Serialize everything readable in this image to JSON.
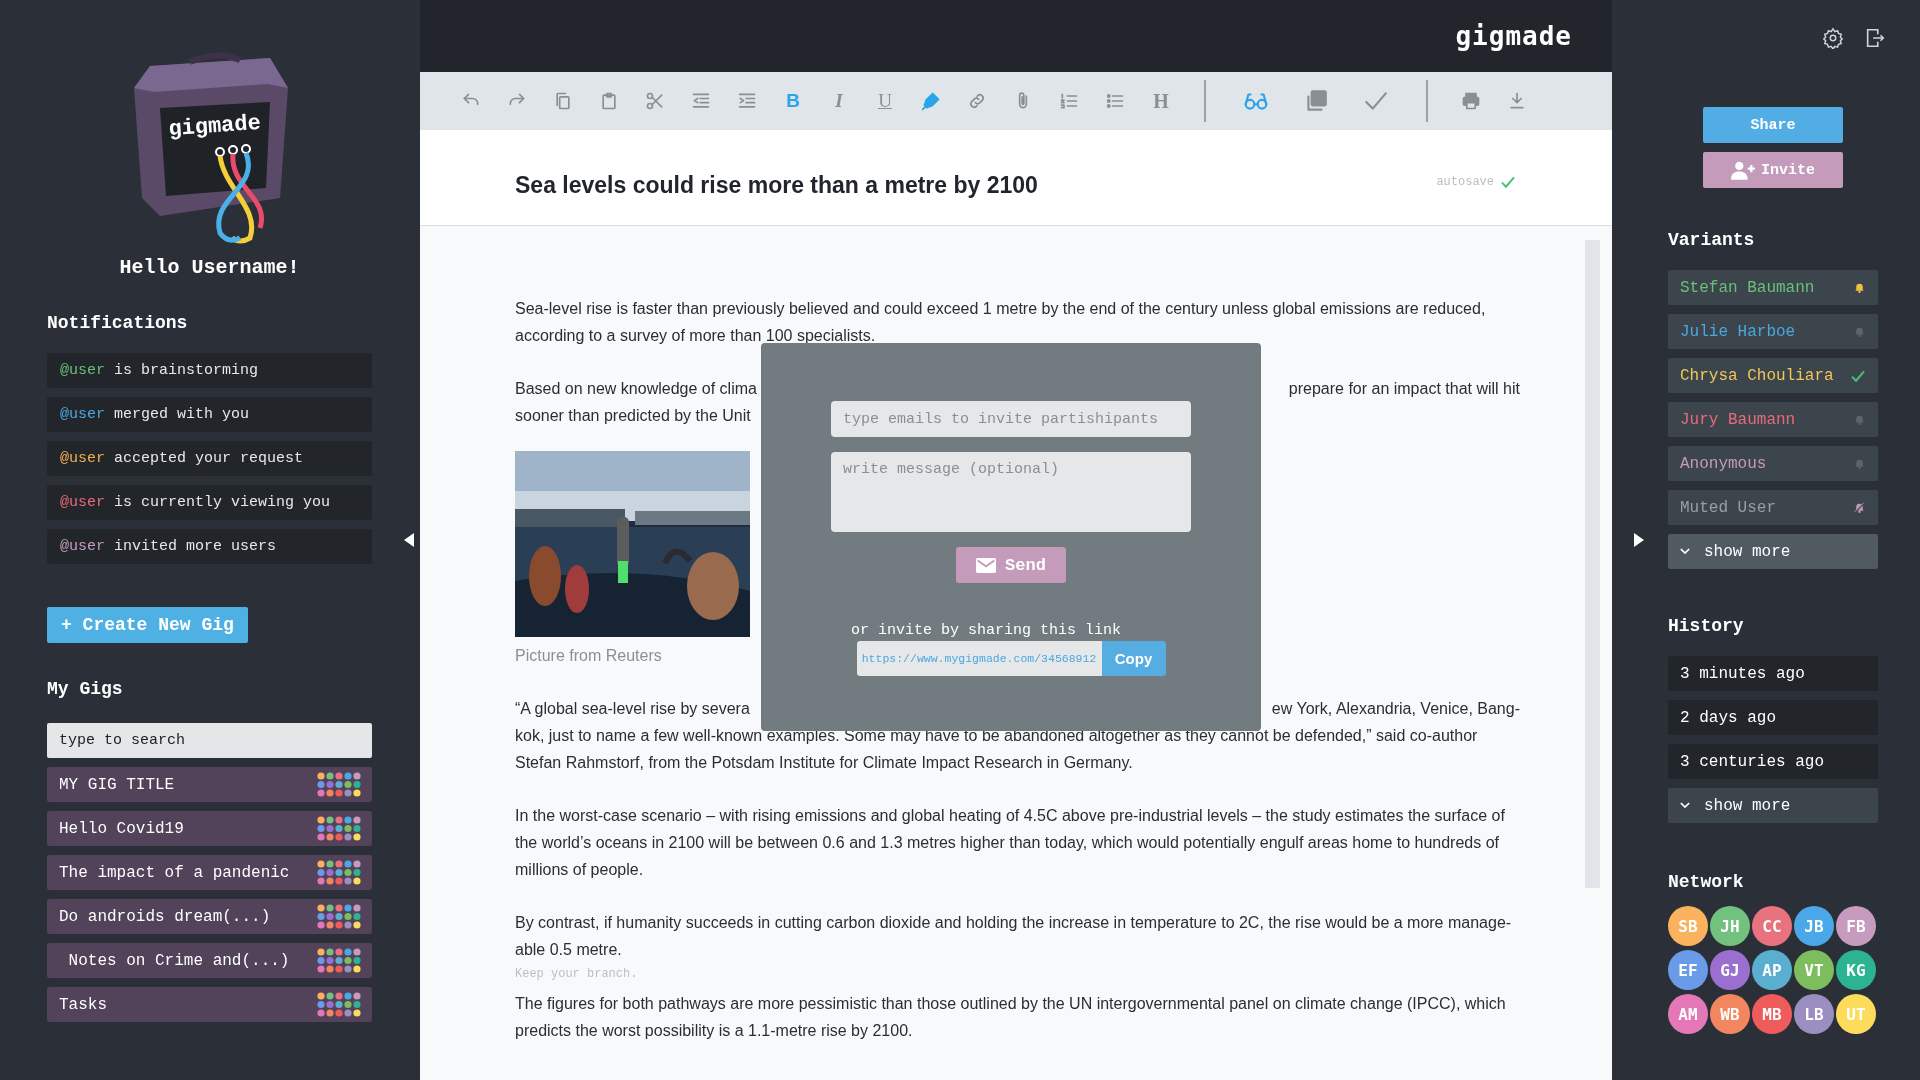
{
  "sidebar_left": {
    "logo_text": "gigmade",
    "greeting": "Hello Username!",
    "notifications_title": "Notifications",
    "notifications": [
      {
        "user": "@user",
        "text": "is brainstorming",
        "color": "#6abf7b"
      },
      {
        "user": "@user",
        "text": "merged with you",
        "color": "#4aa8e0"
      },
      {
        "user": "@user",
        "text": "accepted your request",
        "color": "#f0b04f"
      },
      {
        "user": "@user",
        "text": "is currently viewing you",
        "color": "#e96a7a"
      },
      {
        "user": "@user",
        "text": "invited more users",
        "color": "#c49bbb"
      }
    ],
    "create_button": "+ Create New Gig",
    "gigs_title": "My Gigs",
    "search": {
      "placeholder": "type to search"
    },
    "gigs": [
      {
        "title": "MY GIG TITLE"
      },
      {
        "title": "Hello Covid19"
      },
      {
        "title": "The impact of a pandenic"
      },
      {
        "title": "Do androids dream(...)"
      },
      {
        "title": " Notes on Crime and(...)"
      },
      {
        "title": "Tasks"
      }
    ]
  },
  "header": {
    "brand": "gigmade"
  },
  "toolbar": {
    "groups": [
      {
        "tools": [
          {
            "kind": "undo",
            "active": false
          },
          {
            "kind": "redo",
            "active": false
          },
          {
            "kind": "copy",
            "active": false
          },
          {
            "kind": "paste",
            "active": false
          },
          {
            "kind": "cut",
            "active": false
          },
          {
            "kind": "outdent",
            "active": false
          },
          {
            "kind": "indent",
            "active": false
          },
          {
            "kind": "bold",
            "glyph": "B",
            "active": true
          },
          {
            "kind": "italic",
            "glyph": "I",
            "active": false
          },
          {
            "kind": "underline",
            "glyph": "U",
            "active": false
          },
          {
            "kind": "highlight",
            "active": true
          },
          {
            "kind": "link",
            "active": false
          },
          {
            "kind": "attach",
            "active": false
          },
          {
            "kind": "ordered-list",
            "active": false
          },
          {
            "kind": "bullet-list",
            "active": false
          },
          {
            "kind": "heading",
            "glyph": "H",
            "active": false
          }
        ]
      },
      {
        "tools": [
          {
            "kind": "glasses",
            "active": true
          },
          {
            "kind": "copies",
            "active": false
          },
          {
            "kind": "check",
            "active": false
          }
        ]
      },
      {
        "tools": [
          {
            "kind": "print",
            "active": false
          },
          {
            "kind": "download",
            "active": false
          }
        ]
      }
    ]
  },
  "document": {
    "title": "Sea levels could rise more than a metre by 2100",
    "autosave": "autosave",
    "blocks": [
      {
        "kind": "text",
        "text": "Sea-level rise is faster than previously believed and could exceed 1 metre by the end of the century unless global emissions are reduced, according to a survey of more than 100 specialists."
      },
      {
        "kind": "lines",
        "lines": [
          {
            "left": "Based on new knowledge of clima",
            "right": "prepare for an impact that will hit"
          },
          {
            "left": "sooner than predicted by the Unit"
          }
        ]
      },
      {
        "kind": "picture",
        "caption": "Picture from Reuters"
      },
      {
        "kind": "lines",
        "lines": [
          {
            "left": "“A global sea-level rise by severa",
            "right": "ew York, Alexandria, Venice, Bang-"
          },
          {
            "left": "kok, just to name a few well-known examples. Some may have to be abandoned altogether as they cannot be defended,” said co-author"
          },
          {
            "left": "Stefan Rahmstorf, from the Potsdam Institute for Climate Impact Research in Germany."
          }
        ]
      },
      {
        "kind": "text",
        "text": "In the worst-case scenario – with rising emissions and global heating of 4.5C above pre-industrial levels – the study estimates the surface of the world’s oceans in 2100 will be between 0.6 and 1.3 metres higher than today, which would potentially engulf areas home to hundreds of millions of people."
      },
      {
        "kind": "text",
        "text": "By contrast, if humanity succeeds in cutting carbon dioxide and holding the increase in temperature to 2C, the rise would be a more manage-able 0.5 metre."
      },
      {
        "kind": "note",
        "text": "Keep your branch."
      },
      {
        "kind": "text",
        "text": "The figures for both pathways are more pessimistic than those outlined by the UN intergovernmental panel on climate change (IPCC), which predicts the worst possibility is a 1.1-metre rise by 2100."
      }
    ]
  },
  "invite_dialog": {
    "email_placeholder": "type emails to invite partishipants",
    "message_placeholder": "write message (optional)",
    "send": "Send",
    "share_label": "or invite by sharing this link",
    "link": "https://www.mygigmade.com/34568912",
    "copy": "Copy"
  },
  "sidebar_right": {
    "share": "Share",
    "invite": "Invite",
    "variants_title": "Variants",
    "variants": [
      {
        "name": "Stefan Baumann",
        "color": "#6abf7b",
        "kind": "bell",
        "notify": true
      },
      {
        "name": "Julie Harboe",
        "color": "#4aa8e0",
        "kind": "bell",
        "notify": false
      },
      {
        "name": "Chrysa Chouliara",
        "color": "#f0c85a",
        "kind": "check"
      },
      {
        "name": "Jury Baumann",
        "color": "#e96a7a",
        "kind": "bell",
        "notify": false
      },
      {
        "name": "Anonymous",
        "color": "#c49bbb",
        "kind": "bell",
        "notify": false
      },
      {
        "name": "Muted User",
        "color": "#9a9ea3",
        "kind": "muted"
      }
    ],
    "variants_more": "show more",
    "history_title": "History",
    "history": [
      {
        "label": "3 minutes ago"
      },
      {
        "label": "2 days ago"
      },
      {
        "label": "3 centuries ago"
      }
    ],
    "history_more": "show more",
    "network_title": "Network",
    "network": [
      {
        "initials": "SB",
        "color": "#fbb25e"
      },
      {
        "initials": "JH",
        "color": "#72c17f"
      },
      {
        "initials": "CC",
        "color": "#e8727d"
      },
      {
        "initials": "JB",
        "color": "#4aa8e8"
      },
      {
        "initials": "FB",
        "color": "#c69bbd"
      },
      {
        "initials": "EF",
        "color": "#6a9be8"
      },
      {
        "initials": "GJ",
        "color": "#9b6fd0"
      },
      {
        "initials": "AP",
        "color": "#5aaed0"
      },
      {
        "initials": "VT",
        "color": "#7dbd5e"
      },
      {
        "initials": "KG",
        "color": "#2bb392"
      },
      {
        "initials": "AM",
        "color": "#e377b7"
      },
      {
        "initials": "WB",
        "color": "#f3855f"
      },
      {
        "initials": "MB",
        "color": "#ee5b5b"
      },
      {
        "initials": "LB",
        "color": "#9a8fc0"
      },
      {
        "initials": "UT",
        "color": "#fddc5c"
      }
    ]
  }
}
